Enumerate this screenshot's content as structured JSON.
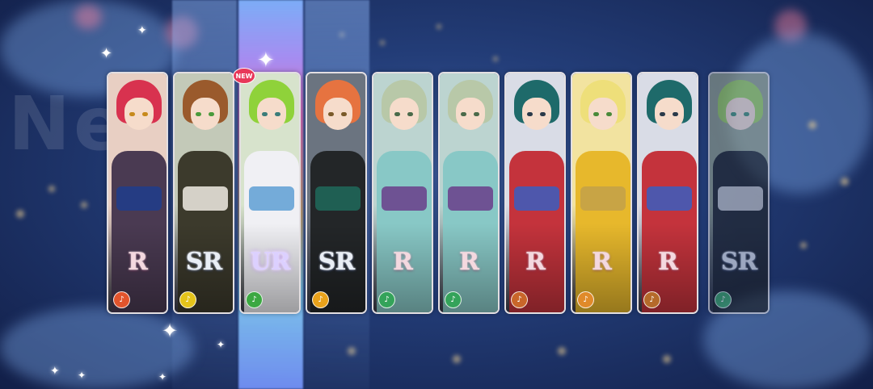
{
  "badge": {
    "new": "NEW"
  },
  "sign_text": "Ne",
  "cards": [
    {
      "rarity": "R",
      "icon": "pink-note-icon",
      "icon_color": "#e2542c",
      "hair": "#d8324f",
      "body": "#4a3a52",
      "accent": "#1e3d8c",
      "bg": "#e8cfc3",
      "eye": "#c78a1c"
    },
    {
      "rarity": "SR",
      "icon": "yellow-note-icon",
      "icon_color": "#e4c41a",
      "hair": "#9a5a2c",
      "body": "#3c3a2c",
      "accent": "#f0ece4",
      "bg": "#c3c9b8",
      "eye": "#4a9a3c"
    },
    {
      "rarity": "UR",
      "icon": "green-note-icon",
      "icon_color": "#3ca842",
      "hair": "#8fd23a",
      "body": "#f0f0f4",
      "accent": "#5e9fd3",
      "bg": "#d7e3cc",
      "eye": "#3b7d7a"
    },
    {
      "rarity": "SR",
      "icon": "yellow-note-icon",
      "icon_color": "#e9a21b",
      "hair": "#e67340",
      "body": "#232628",
      "accent": "#1f6a5a",
      "bg": "#6b7480",
      "eye": "#7a5a2a"
    },
    {
      "rarity": "R",
      "icon": "green-note-icon",
      "icon_color": "#34a35a",
      "hair": "#b8c8a8",
      "body": "#88c8c6",
      "accent": "#6a3d8a",
      "bg": "#bcd4d0",
      "eye": "#4a6a4a"
    },
    {
      "rarity": "R",
      "icon": "green-note-icon",
      "icon_color": "#34a35a",
      "hair": "#b8c8a8",
      "body": "#88c8c6",
      "accent": "#6a3d8a",
      "bg": "#bcd4d0",
      "eye": "#4a6a4a"
    },
    {
      "rarity": "R",
      "icon": "orange-note-icon",
      "icon_color": "#c9662a",
      "hair": "#1e6a6a",
      "body": "#c4333c",
      "accent": "#3a5ec0",
      "bg": "#d9dce6",
      "eye": "#2a3a4a"
    },
    {
      "rarity": "R",
      "icon": "orange-note-icon",
      "icon_color": "#e08a2a",
      "hair": "#eedf7a",
      "body": "#e7b82c",
      "accent": "#c2a04a",
      "bg": "#f2e3a0",
      "eye": "#4a8a3a"
    },
    {
      "rarity": "R",
      "icon": "orange-note-icon",
      "icon_color": "#b56a2a",
      "hair": "#1e6a6a",
      "body": "#c4333c",
      "accent": "#3a5ec0",
      "bg": "#d9dce6",
      "eye": "#2a3a4a"
    },
    {
      "rarity": "SR",
      "icon": "green-note-icon",
      "icon_color": "#3aa662",
      "hair": "#9ccf5a",
      "body": "#232628",
      "accent": "#e8e8e8",
      "bg": "#94a08a",
      "eye": "#3d8a6a"
    }
  ]
}
